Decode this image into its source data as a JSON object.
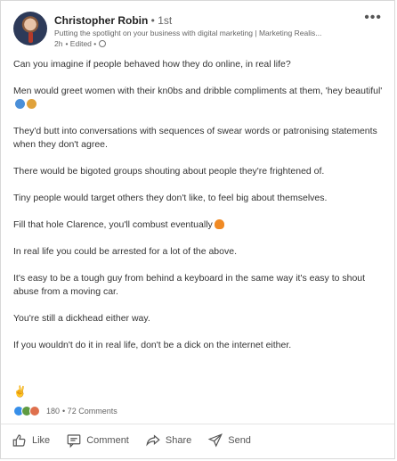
{
  "post": {
    "author_name": "Christopher Robin",
    "author_degree": "• 1st",
    "headline": "Putting the spotlight on your business with digital marketing | Marketing Realis...",
    "time": "2h",
    "edited": "• Edited •",
    "paragraphs": [
      "Can you imagine if people behaved how they do online, in real life?",
      "Men would greet women with their kn0bs and dribble compliments at them, 'hey beautiful'",
      "They'd butt into conversations with sequences of swear words or patronising statements when they don't agree.",
      "There would be bigoted groups shouting about people they're frightened of.",
      "Tiny people would target others they don't like, to feel big about themselves.",
      "Fill that hole Clarence, you'll combust eventually",
      "In real life you could be arrested for a lot of the above.",
      "It's easy to be a tough guy from behind a keyboard in the same way it's easy to shout abuse from a moving car.",
      "You're still a dickhead either way.",
      "If you wouldn't do it in real life, don't be a dick on the internet either."
    ],
    "wave_emoji": "✌",
    "reactions_count": "180",
    "comments_count": "• 72 Comments"
  },
  "actions": {
    "like": "Like",
    "comment": "Comment",
    "share": "Share",
    "send": "Send"
  },
  "colors": {
    "like": "#378fe9",
    "celebrate": "#5f9b41",
    "love": "#df704d"
  }
}
